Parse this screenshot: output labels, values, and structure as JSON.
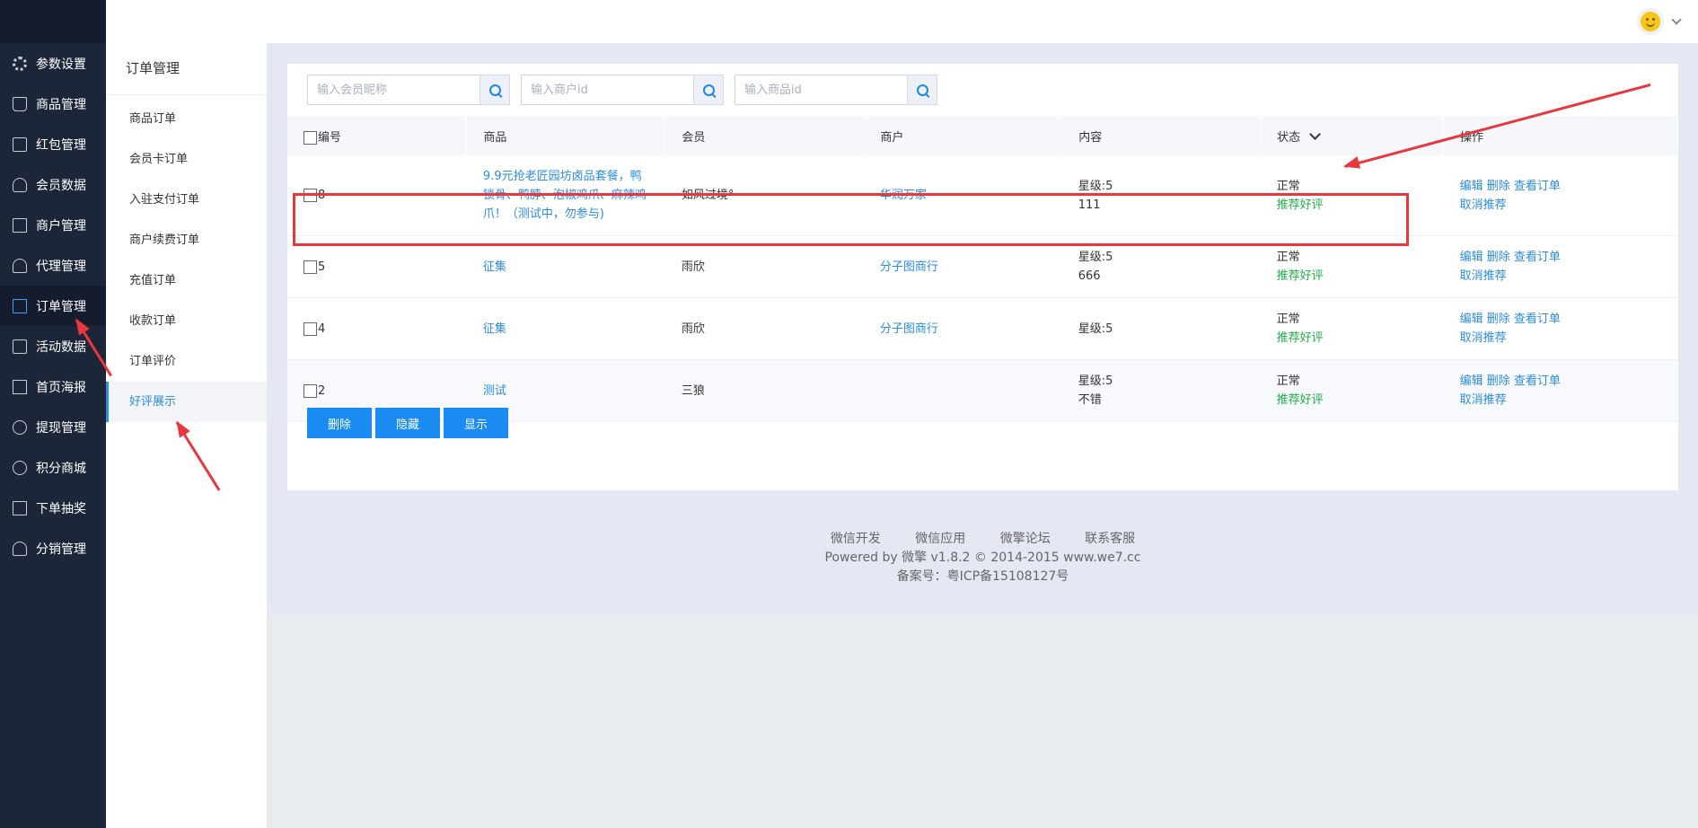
{
  "sidebar": {
    "items": [
      {
        "label": "参数设置",
        "icon": "gear-icon"
      },
      {
        "label": "商品管理",
        "icon": "shopping-bag-icon"
      },
      {
        "label": "红包管理",
        "icon": "red-packet-icon"
      },
      {
        "label": "会员数据",
        "icon": "user-icon"
      },
      {
        "label": "商户管理",
        "icon": "shop-icon"
      },
      {
        "label": "代理管理",
        "icon": "agent-icon"
      },
      {
        "label": "订单管理",
        "icon": "order-icon",
        "active": true
      },
      {
        "label": "活动数据",
        "icon": "activity-icon"
      },
      {
        "label": "首页海报",
        "icon": "poster-icon"
      },
      {
        "label": "提现管理",
        "icon": "withdraw-icon"
      },
      {
        "label": "积分商城",
        "icon": "points-icon"
      },
      {
        "label": "下单抽奖",
        "icon": "lottery-icon"
      },
      {
        "label": "分销管理",
        "icon": "distribution-icon"
      }
    ]
  },
  "subsidebar": {
    "title": "订单管理",
    "items": [
      "商品订单",
      "会员卡订单",
      "入驻支付订单",
      "商户续费订单",
      "充值订单",
      "收款订单",
      "订单评价",
      "好评展示"
    ],
    "active_index": 7
  },
  "search": {
    "member_placeholder": "输入会员昵称",
    "merchant_placeholder": "输入商户id",
    "goods_placeholder": "输入商品id"
  },
  "table": {
    "headers": {
      "id": "编号",
      "goods": "商品",
      "member": "会员",
      "merchant": "商户",
      "content": "内容",
      "status": "状态",
      "actions": "操作"
    },
    "rows": [
      {
        "id": "8",
        "goods": "9.9元抢老匠园坊卤品套餐，鸭锁骨、鸭脖、泡椒鸡爪、麻辣鸡爪！（测试中，勿参与)",
        "member": "如风过境°",
        "merchant": "华润万家",
        "rating": "星级:5",
        "comment": "111",
        "status": "正常",
        "recommend": "推荐好评"
      },
      {
        "id": "5",
        "goods": "征集",
        "member": "雨欣",
        "merchant": "分子图商行",
        "rating": "星级:5",
        "comment": "666",
        "status": "正常",
        "recommend": "推荐好评"
      },
      {
        "id": "4",
        "goods": "征集",
        "member": "雨欣",
        "merchant": "分子图商行",
        "rating": "星级:5",
        "comment": "",
        "status": "正常",
        "recommend": "推荐好评"
      },
      {
        "id": "2",
        "goods": "测试",
        "member": "三狼",
        "merchant": "",
        "rating": "星级:5",
        "comment": "不错",
        "status": "正常",
        "recommend": "推荐好评"
      }
    ],
    "action_labels": {
      "edit": "编辑",
      "delete": "删除",
      "view_order": "查看订单",
      "cancel_recommend": "取消推荐"
    }
  },
  "bulk_actions": {
    "delete": "删除",
    "hide": "隐藏",
    "show": "显示"
  },
  "footer": {
    "links": [
      "微信开发",
      "微信应用",
      "微擎论坛",
      "联系客服"
    ],
    "powered": "Powered by 微擎 v1.8.2 © 2014-2015 www.we7.cc",
    "icp": "备案号：粤ICP备15108127号"
  },
  "colors": {
    "accent": "#1a8bf0",
    "link": "#2b8de3",
    "success": "#1fb147",
    "annotation": "#e8383d",
    "sidebar_bg": "#1d2539"
  },
  "icons": {
    "search": "search-icon",
    "avatar": "smiley-avatar-icon",
    "sort": "chevron-down-icon"
  }
}
